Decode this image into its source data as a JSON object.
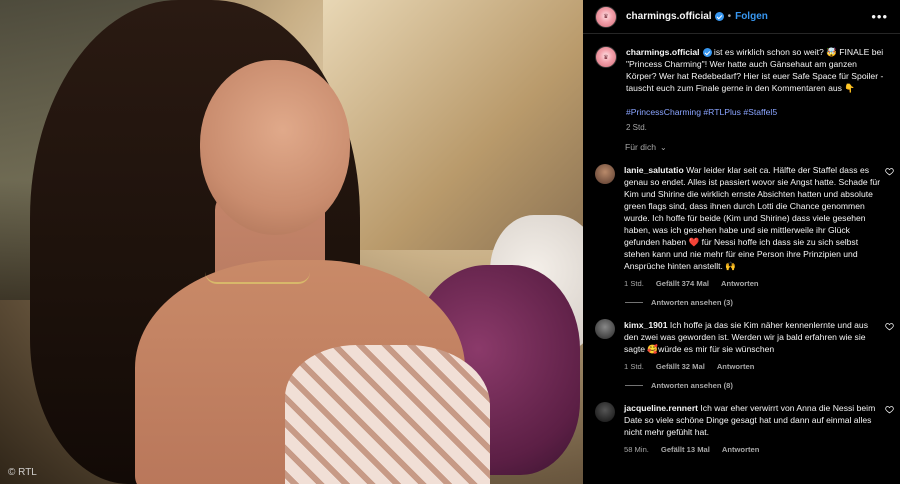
{
  "photo": {
    "watermark": "© RTL"
  },
  "header": {
    "username": "charmings.official",
    "separator": "•",
    "follow_label": "Folgen",
    "more_icon": "more-horizontal-icon"
  },
  "post": {
    "username": "charmings.official",
    "caption": " ist es wirklich schon so weit? 🤯 FINALE bei \"Princess Charming\"! Wer hatte auch Gänsehaut am ganzen Körper? Wer hat Redebedarf? Hier ist euer Safe Space für Spoiler - tauscht euch zum Finale gerne in den Kommentaren aus 👇",
    "hashtags": "#PrincessCharming #RTLPlus #Staffel5",
    "time": "2 Std.",
    "sort_label": "Für dich",
    "sort_chevron": "⌄"
  },
  "comments": [
    {
      "username": "lanie_salutatio",
      "text": " War leider klar seit ca. Hälfte der Staffel dass es genau so endet. Alles ist passiert wovor sie Angst hatte. Schade für Kim und Shirine die wirklich ernste Absichten hatten und absolute green flags sind, dass ihnen durch Lotti die Chance genommen wurde. Ich hoffe für beide (Kim und Shirine) dass viele gesehen haben, was ich gesehen habe und sie mittlerweile ihr Glück gefunden haben ❤️ für Nessi hoffe ich dass sie zu sich selbst stehen kann und nie mehr für eine Person ihre Prinzipien und Ansprüche hinten anstellt. 🙌",
      "time": "1 Std.",
      "likes": "Gefällt 374 Mal",
      "reply": "Antworten",
      "view_replies": "Antworten ansehen (3)",
      "avatar_color": "#6b4a3a"
    },
    {
      "username": "kimx_1901",
      "text": " Ich hoffe ja das sie Kim näher kennenlernte und aus den zwei was geworden ist. Werden wir ja bald erfahren wie sie sagte 🥰würde es mir für sie wünschen",
      "time": "1 Std.",
      "likes": "Gefällt 32 Mal",
      "reply": "Antworten",
      "view_replies": "Antworten ansehen (8)",
      "avatar_color": "#4a4a4a"
    },
    {
      "username": "jacqueline.rennert",
      "text": " Ich war eher verwirrt von Anna die Nessi beim Date so viele schöne Dinge gesagt hat und dann auf einmal alles nicht mehr gefühlt hat.",
      "time": "58 Min.",
      "likes": "Gefällt 13 Mal",
      "reply": "Antworten",
      "avatar_color": "#2b2b2b"
    }
  ],
  "colors": {
    "link_blue": "#3897f0",
    "hashtag": "#8aa4ff",
    "muted": "#a8a8a8"
  }
}
